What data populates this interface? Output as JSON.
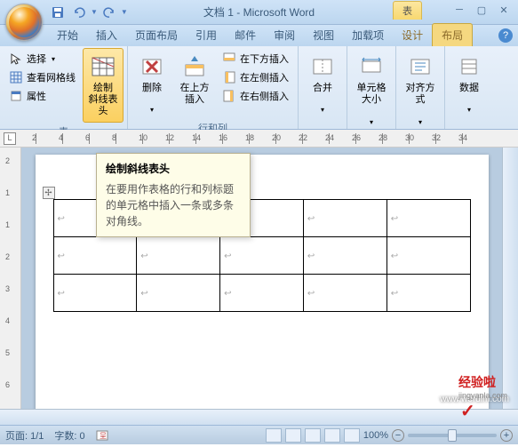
{
  "title": "文档 1 - Microsoft Word",
  "context_tab": "表",
  "qat": {
    "save": "save",
    "undo": "undo",
    "redo": "redo"
  },
  "tabs": [
    "开始",
    "插入",
    "页面布局",
    "引用",
    "邮件",
    "审阅",
    "视图",
    "加载项",
    "设计",
    "布局"
  ],
  "active_tab": 9,
  "ribbon": {
    "group1": {
      "label": "表",
      "select": "选择",
      "gridlines": "查看网格线",
      "properties": "属性",
      "draw_diag": "绘制\n斜线表头"
    },
    "group2": {
      "label": "行和列",
      "delete": "删除",
      "insert_above": "在上方\n插入",
      "insert_below": "在下方插入",
      "insert_left": "在左侧插入",
      "insert_right": "在右侧插入"
    },
    "group3": {
      "merge": "合并"
    },
    "group4": {
      "cellsize": "单元格大小"
    },
    "group5": {
      "align": "对齐方式"
    },
    "group6": {
      "data": "数据"
    }
  },
  "tooltip": {
    "title": "绘制斜线表头",
    "body": "在要用作表格的行和列标题的单元格中插入一条或多条对角线。"
  },
  "ruler_h_ticks": [
    2,
    4,
    6,
    8,
    10,
    12,
    14,
    16,
    18,
    20,
    22,
    24,
    26,
    28,
    30,
    32,
    34
  ],
  "ruler_v_ticks": [
    2,
    1,
    1,
    2,
    3,
    4,
    5,
    6
  ],
  "status": {
    "page": "页面: 1/1",
    "words": "字数: 0",
    "zoom": "100%"
  },
  "watermark1": "www.wordlm.com",
  "watermark2": "经验啦",
  "watermark2_sub": "jingyanla.com"
}
